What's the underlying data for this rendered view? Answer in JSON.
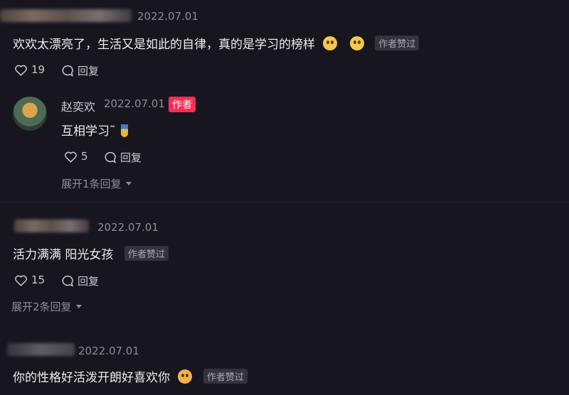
{
  "comments": [
    {
      "date": "2022.07.01",
      "text": "欢欢太漂亮了，生活又是如此的自律，真的是学习的榜样",
      "badge": "作者赞过",
      "likes": "19",
      "reply_label": "回复"
    },
    {
      "date": "2022.07.01",
      "text": "活力满满 阳光女孩",
      "badge": "作者赞过",
      "likes": "15",
      "reply_label": "回复",
      "expand_label": "展开2条回复"
    },
    {
      "date": "2022.07.01",
      "text": "你的性格好活泼开朗好喜欢你",
      "badge": "作者赞过"
    }
  ],
  "author_reply": {
    "name": "赵奕欢",
    "date": "2022.07.01",
    "badge": "作者",
    "text": "互相学习˜",
    "likes": "5",
    "reply_label": "回复",
    "expand_label": "展开1条回复"
  },
  "colors": {
    "background": "#17161f",
    "author_badge": "#fe2c55"
  }
}
